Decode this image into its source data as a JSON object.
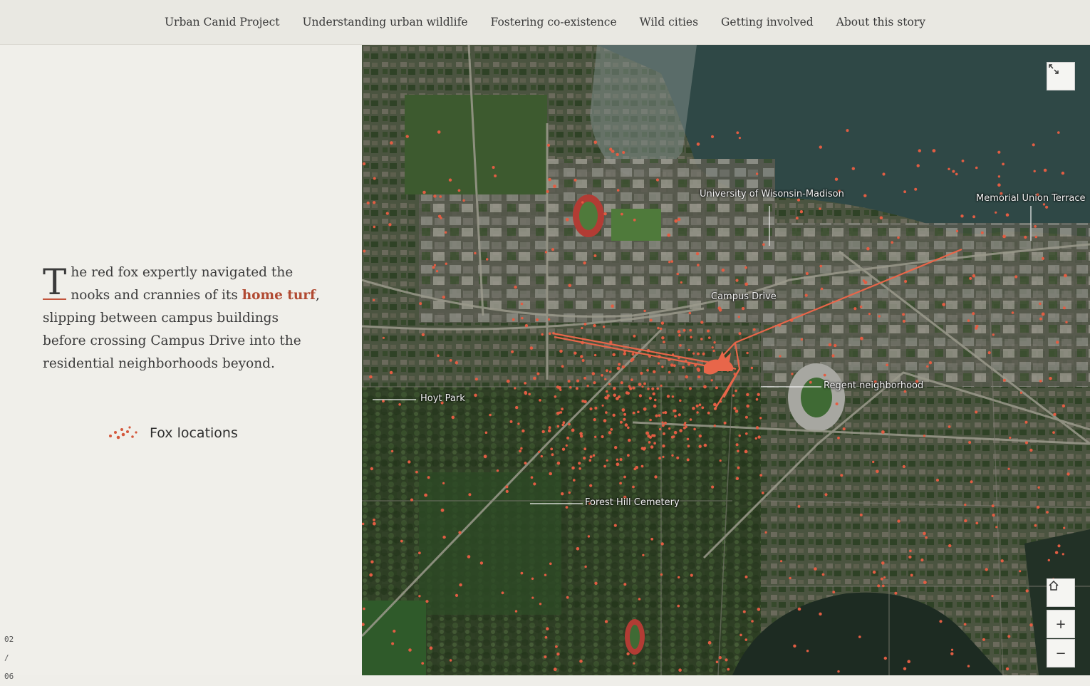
{
  "nav": {
    "items": [
      "Urban Canid Project",
      "Understanding urban wildlife",
      "Fostering co-existence",
      "Wild cities",
      "Getting involved",
      "About this story"
    ]
  },
  "story": {
    "dropcap": "T",
    "text_before": "he red fox expertly navigated the nooks and crannies of its ",
    "highlight": "home turf",
    "text_after": ", slipping between campus buildings before crossing Campus Drive into the residential neighborhoods beyond."
  },
  "legend": {
    "label": "Fox locations",
    "icon": "dots-cluster-icon"
  },
  "pager": {
    "current": "02",
    "sep": "/",
    "total": "06"
  },
  "map": {
    "labels": {
      "uw": "University of Wisonsin-Madison",
      "memorial": "Memorial Union Terrace",
      "campus_drive": "Campus Drive",
      "regent": "Regent neighborhood",
      "hoyt": "Hoyt Park",
      "cemetery": "Forest Hill Cemetery"
    },
    "buttons": {
      "fullscreen": "expand-icon",
      "home": "home-icon",
      "zoom_in": "+",
      "zoom_out": "−"
    }
  },
  "colors": {
    "accent": "#b14a32",
    "track": "#e0603f",
    "background": "#efeee9"
  }
}
